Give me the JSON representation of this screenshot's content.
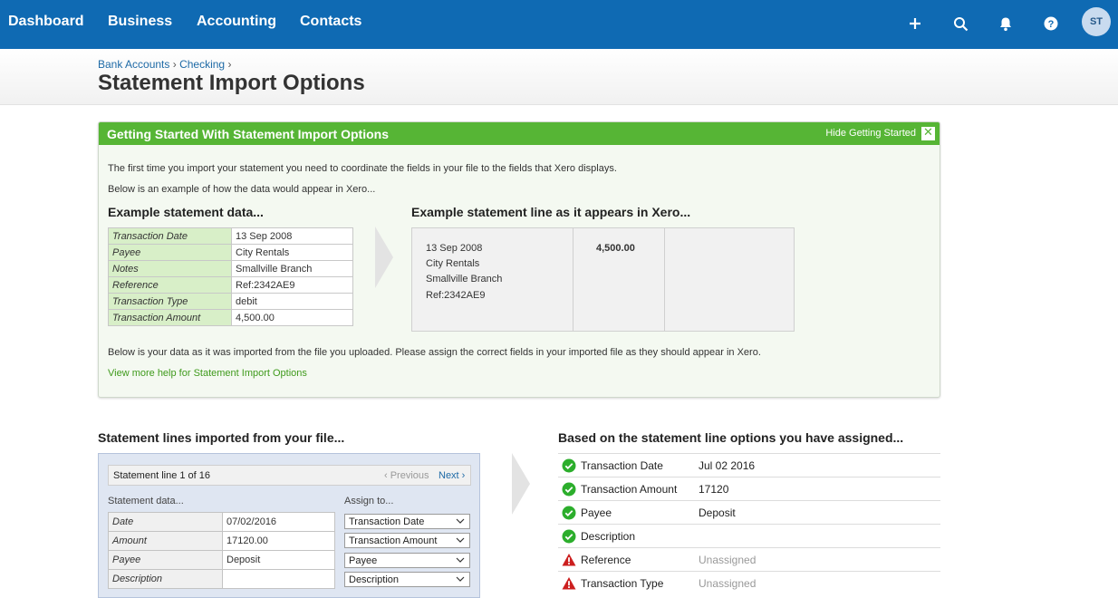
{
  "nav": {
    "items": [
      "Dashboard",
      "Business",
      "Accounting",
      "Contacts"
    ],
    "icons": [
      "plus-icon",
      "search-icon",
      "bell-icon",
      "help-icon"
    ],
    "avatar_initials": "ST"
  },
  "breadcrumb": {
    "items": [
      "Bank Accounts",
      "Checking"
    ],
    "separator": "›"
  },
  "page": {
    "title": "Statement Import Options"
  },
  "getting_started": {
    "title": "Getting Started With Statement Import Options",
    "hide_label": "Hide Getting Started",
    "intro1": "The first time you import your statement you need to coordinate the fields in your file to the fields that Xero displays.",
    "intro2": "Below is an example of how the data would appear in Xero...",
    "example_heading": "Example statement data...",
    "xero_heading": "Example statement line as it appears in Xero...",
    "example_rows": [
      {
        "label": "Transaction Date",
        "value": "13 Sep 2008"
      },
      {
        "label": "Payee",
        "value": "City Rentals"
      },
      {
        "label": "Notes",
        "value": "Smallville Branch"
      },
      {
        "label": "Reference",
        "value": "Ref:2342AE9"
      },
      {
        "label": "Transaction Type",
        "value": "debit"
      },
      {
        "label": "Transaction Amount",
        "value": "4,500.00"
      }
    ],
    "xero_lines": [
      "13 Sep 2008",
      "City Rentals",
      "Smallville Branch",
      "Ref:2342AE9"
    ],
    "xero_amount": "4,500.00",
    "outro": "Below is your data as it was imported from the file you uploaded. Please assign the correct fields in your imported file as they should appear in Xero.",
    "help_link": "View more help for Statement Import Options"
  },
  "imported": {
    "heading": "Statement lines imported from your file...",
    "pager_label": "Statement line 1 of 16",
    "prev_label": "‹ Previous",
    "next_label": "Next ›",
    "data_col_head": "Statement data...",
    "assign_col_head": "Assign to...",
    "rows": [
      {
        "label": "Date",
        "value": "07/02/2016",
        "assign": "Transaction Date"
      },
      {
        "label": "Amount",
        "value": "17120.00",
        "assign": "Transaction Amount"
      },
      {
        "label": "Payee",
        "value": "Deposit",
        "assign": "Payee"
      },
      {
        "label": "Description",
        "value": "",
        "assign": "Description"
      }
    ]
  },
  "assigned": {
    "heading": "Based on the statement line options you have assigned...",
    "rows": [
      {
        "label": "Transaction Date",
        "value": "Jul 02 2016",
        "status": "ok"
      },
      {
        "label": "Transaction Amount",
        "value": "17120",
        "status": "ok"
      },
      {
        "label": "Payee",
        "value": "Deposit",
        "status": "ok"
      },
      {
        "label": "Description",
        "value": "",
        "status": "ok"
      },
      {
        "label": "Reference",
        "value": "Unassigned",
        "status": "warning"
      },
      {
        "label": "Transaction Type",
        "value": "Unassigned",
        "status": "warning"
      }
    ]
  },
  "colors": {
    "nav": "#0f6ab3",
    "green": "#56b535",
    "ok": "#2cae2c",
    "warning": "#cc1f1f"
  }
}
